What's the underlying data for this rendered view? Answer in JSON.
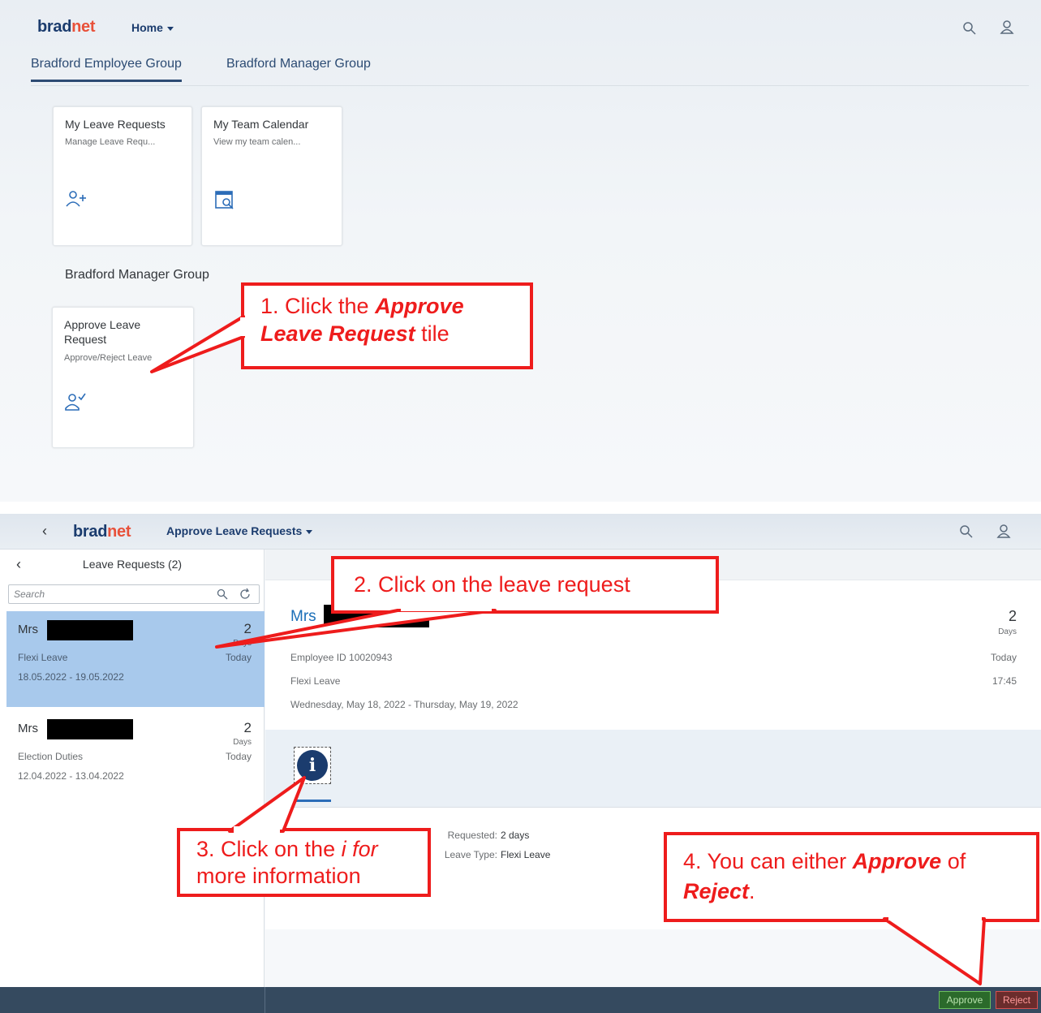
{
  "screen1": {
    "logo": {
      "part1": "brad",
      "part2": "net"
    },
    "home_label": "Home",
    "group_tabs": [
      {
        "label": "Bradford Employee Group"
      },
      {
        "label": "Bradford Manager Group"
      }
    ],
    "tiles": [
      {
        "title": "My Leave Requests",
        "subtitle": "Manage Leave Requ...",
        "icon": "add-user-icon"
      },
      {
        "title": "My Team Calendar",
        "subtitle": "View my team calen...",
        "icon": "calendar-search-icon"
      }
    ],
    "section_title": "Bradford Manager Group",
    "manager_tile": {
      "title": "Approve Leave Request",
      "subtitle": "Approve/Reject Leave",
      "icon": "user-check-icon"
    }
  },
  "screen2": {
    "logo": {
      "part1": "brad",
      "part2": "net"
    },
    "app_title": "Approve Leave Requests",
    "master_title": "Leave Requests (2)",
    "search_placeholder": "Search",
    "requests": [
      {
        "name": "Mrs",
        "days": "2",
        "unit": "Days",
        "type": "Flexi Leave",
        "when": "Today",
        "dates": "18.05.2022 - 19.05.2022",
        "selected": true
      },
      {
        "name": "Mrs",
        "days": "2",
        "unit": "Days",
        "type": "Election Duties",
        "when": "Today",
        "dates": "12.04.2022 - 13.04.2022",
        "selected": false
      }
    ],
    "detail": {
      "name": "Mrs",
      "employee_id": "Employee ID 10020943",
      "leave_type": "Flexi Leave",
      "date_range": "Wednesday, May 18, 2022 - Thursday, May 19, 2022",
      "days": "2",
      "unit": "Days",
      "submitted_day": "Today",
      "submitted_time": "17:45",
      "info_tab_glyph": "i",
      "info_rows": [
        {
          "label": "Requested:",
          "value": "2 days"
        },
        {
          "label": "Leave Type:",
          "value": "Flexi Leave"
        }
      ]
    },
    "footer": {
      "approve_label": "Approve",
      "reject_label": "Reject",
      "approve_color": "#2b6a2b",
      "reject_color": "#6b2c2c"
    }
  },
  "annotations": {
    "step1": {
      "prefix": "1. Click the ",
      "bold1": "Approve",
      "bold2": "Leave Request",
      "suffix": " tile"
    },
    "step2": {
      "text": "2. Click on the leave request"
    },
    "step3": {
      "prefix": "3. Click on the ",
      "italic": "i for",
      "suffix": "more information"
    },
    "step4": {
      "prefix": "4. You can either ",
      "bold1": "Approve",
      "mid": " of",
      "bold2": "Reject",
      "suffix": "."
    },
    "color": "#ee1c1c"
  }
}
